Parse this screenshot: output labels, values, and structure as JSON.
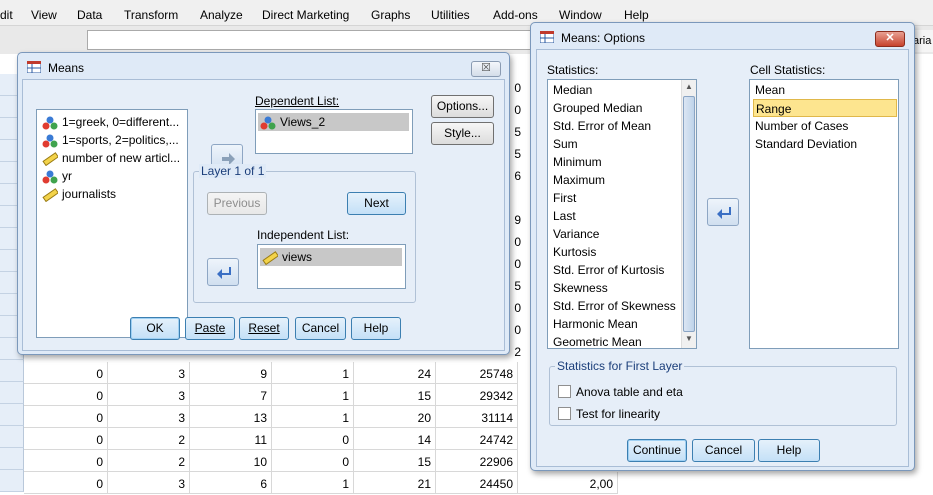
{
  "menubar": [
    "dit",
    "View",
    "Data",
    "Transform",
    "Analyze",
    "Direct Marketing",
    "Graphs",
    "Utilities",
    "Add-ons",
    "Window",
    "Help"
  ],
  "right_var_fragment": "aria",
  "grid_rows": [
    [
      "0",
      "3",
      "9",
      "1",
      "24",
      "25748",
      ""
    ],
    [
      "0",
      "3",
      "7",
      "1",
      "15",
      "29342",
      ""
    ],
    [
      "0",
      "3",
      "13",
      "1",
      "20",
      "31114",
      ""
    ],
    [
      "0",
      "2",
      "11",
      "0",
      "14",
      "24742",
      ""
    ],
    [
      "0",
      "2",
      "10",
      "0",
      "15",
      "22906",
      ""
    ],
    [
      "0",
      "3",
      "6",
      "1",
      "21",
      "24450",
      "2,00"
    ]
  ],
  "peek_col_values": [
    "0",
    "0",
    "5",
    "5",
    "6",
    "9",
    "0",
    "0",
    "5",
    "0",
    "0",
    "2"
  ],
  "means": {
    "title": "Means",
    "close_label": "☒",
    "variables": [
      {
        "label": "1=greek, 0=different...",
        "icon": "nominal-icon"
      },
      {
        "label": "1=sports, 2=politics,...",
        "icon": "nominal-icon"
      },
      {
        "label": "number of new articl...",
        "icon": "scale-icon"
      },
      {
        "label": "yr",
        "icon": "nominal-icon"
      },
      {
        "label": "journalists",
        "icon": "scale-icon"
      }
    ],
    "dependent_label": "Dependent List:",
    "dependent_items": [
      "Views_2"
    ],
    "layer_label": "Layer 1 of 1",
    "previous_label": "Previous",
    "next_label": "Next",
    "independent_label": "Independent List:",
    "independent_items": [
      "views"
    ],
    "options_label": "Options...",
    "style_label": "Style...",
    "buttons": {
      "ok": "OK",
      "paste": "Paste",
      "reset": "Reset",
      "cancel": "Cancel",
      "help": "Help"
    }
  },
  "options": {
    "title": "Means: Options",
    "statistics_label": "Statistics:",
    "statistics": [
      "Median",
      "Grouped Median",
      "Std. Error of Mean",
      "Sum",
      "Minimum",
      "Maximum",
      "First",
      "Last",
      "Variance",
      "Kurtosis",
      "Std. Error of Kurtosis",
      "Skewness",
      "Std. Error of Skewness",
      "Harmonic Mean",
      "Geometric Mean"
    ],
    "cell_label": "Cell Statistics:",
    "cell_statistics": [
      "Mean",
      "Range",
      "Number of Cases",
      "Standard Deviation"
    ],
    "selected_cell": "Range",
    "first_layer_label": "Statistics for First Layer",
    "anova_label": "Anova table and eta",
    "linearity_label": "Test for linearity",
    "buttons": {
      "continue": "Continue",
      "cancel": "Cancel",
      "help": "Help"
    }
  }
}
